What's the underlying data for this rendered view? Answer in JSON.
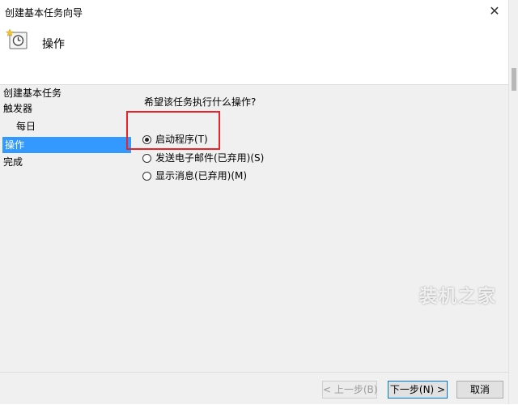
{
  "window": {
    "title": "创建基本任务向导",
    "close_glyph": "✕"
  },
  "header": {
    "title": "操作",
    "icon": "task-clock-icon"
  },
  "nav": {
    "items": [
      {
        "label": "创建基本任务",
        "selected": false
      },
      {
        "label": "触发器",
        "selected": false
      },
      {
        "label": "每日",
        "selected": false
      },
      {
        "label": "操作",
        "selected": true
      },
      {
        "label": "完成",
        "selected": false
      }
    ]
  },
  "main": {
    "question": "希望该任务执行什么操作?",
    "options": [
      {
        "label": "启动程序(T)",
        "checked": true
      },
      {
        "label": "发送电子邮件(已弃用)(S)",
        "checked": false
      },
      {
        "label": "显示消息(已弃用)(M)",
        "checked": false
      }
    ],
    "highlight_color": "#e8232a"
  },
  "footer": {
    "back_label": "< 上一步(B)",
    "next_label": "下一步(N) >",
    "cancel_label": "取消"
  },
  "watermark": {
    "text": "装机之家"
  },
  "colors": {
    "selection": "#3399ff",
    "panel": "#f0f0f0"
  }
}
